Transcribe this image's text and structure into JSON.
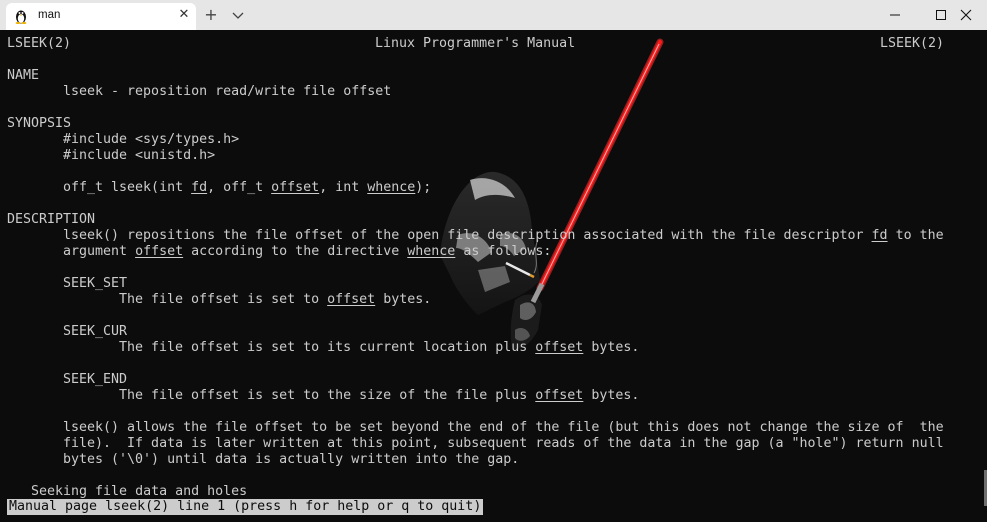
{
  "window": {
    "tab_title": "man",
    "new_tab_label": "+",
    "close_tab_label": "✕"
  },
  "man": {
    "header_left": "LSEEK(2)",
    "header_center": "Linux Programmer's Manual",
    "header_right": "LSEEK(2)",
    "name_heading": "NAME",
    "name_text": "lseek - reposition read/write file offset",
    "synopsis_heading": "SYNOPSIS",
    "include1": "#include <sys/types.h>",
    "include2": "#include <unistd.h>",
    "proto_prefix": "off_t lseek(int ",
    "proto_fd": "fd",
    "proto_mid1": ", off_t ",
    "proto_offset": "offset",
    "proto_mid2": ", int ",
    "proto_whence": "whence",
    "proto_end": ");",
    "description_heading": "DESCRIPTION",
    "desc1_a": "lseek() repositions the file offset of the open file description associated with the file descriptor ",
    "desc1_fd": "fd",
    "desc1_b": " to the",
    "desc2_a": "argument ",
    "desc2_offset": "offset",
    "desc2_b": " according to the directive ",
    "desc2_whence": "whence",
    "desc2_c": " as follows:",
    "seek_set": "SEEK_SET",
    "seek_set_a": "The file offset is set to ",
    "seek_set_offset": "offset",
    "seek_set_b": " bytes.",
    "seek_cur": "SEEK_CUR",
    "seek_cur_a": "The file offset is set to its current location plus ",
    "seek_cur_offset": "offset",
    "seek_cur_b": " bytes.",
    "seek_end": "SEEK_END",
    "seek_end_a": "The file offset is set to the size of the file plus ",
    "seek_end_offset": "offset",
    "seek_end_b": " bytes.",
    "para1": "lseek() allows the file offset to be set beyond the end of the file (but this does not change the size of  the",
    "para2": "file).  If data is later written at this point, subsequent reads of the data in the gap (a \"hole\") return null",
    "para3": "bytes ('\\0') until data is actually written into the gap.",
    "subheading": "Seeking file data and holes",
    "status": "Manual page lseek(2) line 1 (press h for help or q to quit)"
  },
  "colors": {
    "terminal_bg": "#0c0c0c",
    "terminal_fg": "#cccccc",
    "titlebar_bg": "#e6e6e6",
    "lightsaber": "#ff2020"
  },
  "icons": [
    "linux-penguin-icon",
    "close-icon",
    "plus-icon",
    "chevron-down-icon",
    "minimize-icon",
    "maximize-icon",
    "window-close-icon"
  ]
}
